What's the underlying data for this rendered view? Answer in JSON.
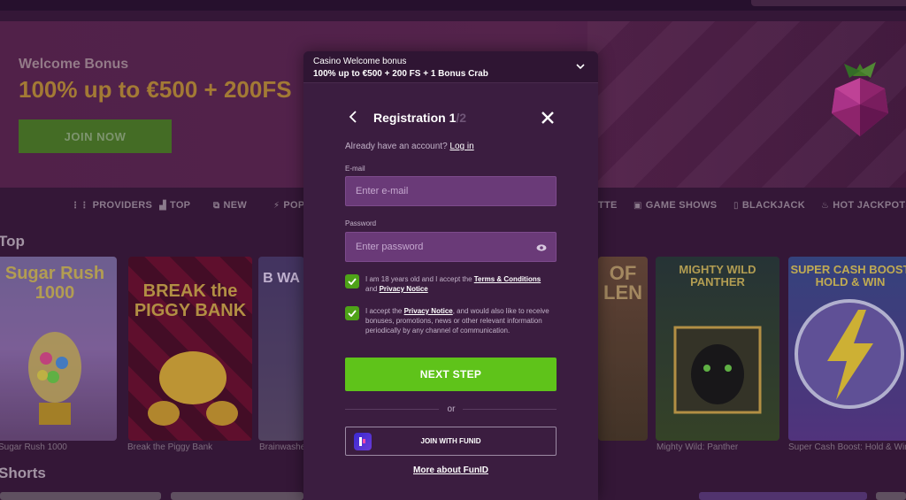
{
  "hero": {
    "subtitle": "Welcome Bonus",
    "title": "100% up to €500 + 200FS",
    "cta_label": "JOIN NOW"
  },
  "nav": {
    "items": [
      {
        "label": "PROVIDERS",
        "icon": "grid-icon"
      },
      {
        "label": "TOP",
        "icon": "podium-icon"
      },
      {
        "label": "NEW",
        "icon": "new-window-icon"
      },
      {
        "label": "POP",
        "icon": "bolt-icon"
      },
      {
        "label": "TTE",
        "icon": ""
      },
      {
        "label": "GAME SHOWS",
        "icon": "tv-icon"
      },
      {
        "label": "BLACKJACK",
        "icon": "cards-icon"
      },
      {
        "label": "HOT JACKPOTS",
        "icon": "flame-icon"
      }
    ]
  },
  "sections": {
    "top_title": "Top",
    "shorts_title": "Shorts"
  },
  "games": [
    {
      "title": "Sugar Rush 1000",
      "art_text": "Sugar Rush 1000"
    },
    {
      "title": "Break the Piggy Bank",
      "art_text": "BREAK the PIGGY BANK"
    },
    {
      "title": "Brainwashe",
      "art_text": "B WA"
    },
    {
      "title": "",
      "art_text": "OF LEN"
    },
    {
      "title": "Mighty Wild: Panther",
      "art_text": "MIGHTY WILD PANTHER"
    },
    {
      "title": "Super Cash Boost: Hold & Win",
      "art_text": "SUPER CASH BOOST HOLD & WIN"
    }
  ],
  "modal": {
    "bonus_bar": {
      "title": "Casino Welcome bonus",
      "text": "100% up to €500 + 200 FS + 1 Bonus Crab"
    },
    "registration": {
      "title": "Registration",
      "step_current": "1",
      "step_total": "/2"
    },
    "have_account_text": "Already have an account?",
    "login_link": "Log in",
    "email": {
      "label": "E-mail",
      "placeholder": "Enter e-mail",
      "value": ""
    },
    "password": {
      "label": "Password",
      "placeholder": "Enter password",
      "value": ""
    },
    "consent_age": {
      "checked": true,
      "text_before": "I am 18 years old and I accept the",
      "terms_link": "Terms & Conditions",
      "text_and": "and",
      "privacy_link": "Privacy Notice"
    },
    "consent_marketing": {
      "checked": true,
      "text_before": "I accept the",
      "privacy_link": "Privacy Notice",
      "text_after": ", and would also like to receive bonuses, promotions, news or other relevant information periodically by any channel of communication."
    },
    "next_step_label": "NEXT STEP",
    "or_label": "or",
    "funid_button_label": "JOIN WITH FUNID",
    "more_funid_label": "More about FunID"
  },
  "colors": {
    "primary_green": "#5fc31a",
    "modal_bg": "#3b1d40",
    "field_bg": "#6a3a78",
    "hero_gold": "#b88a3a"
  }
}
